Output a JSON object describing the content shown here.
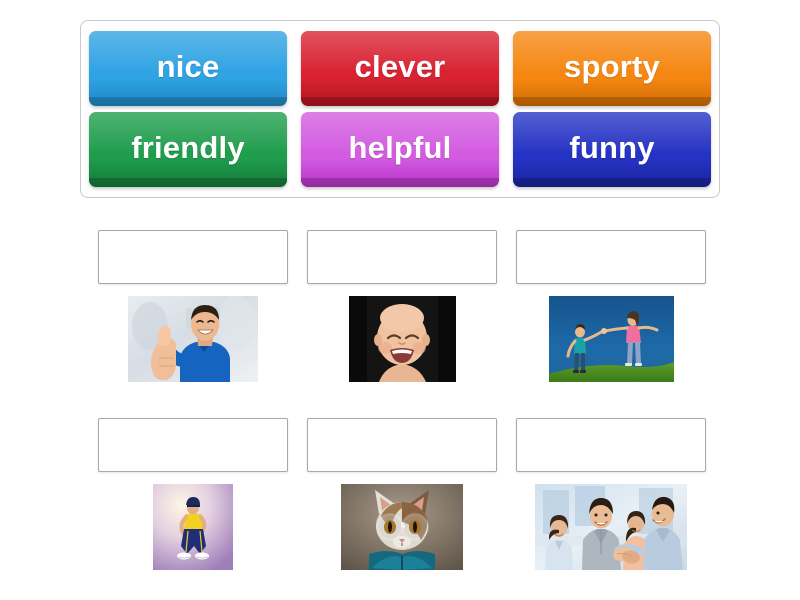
{
  "activity": {
    "type": "match-up-drag-and-drop",
    "background_color": "#ffffff"
  },
  "word_bank": {
    "border_color": "#c9c9c9",
    "rows": [
      [
        {
          "id": "nice",
          "label": "nice",
          "color": "#2fa3e3",
          "color_dark": "#1f87c4"
        },
        {
          "id": "clever",
          "label": "clever",
          "color": "#d92232",
          "color_dark": "#b0151f"
        },
        {
          "id": "sporty",
          "label": "sporty",
          "color": "#f68712",
          "color_dark": "#d06d05"
        }
      ],
      [
        {
          "id": "friendly",
          "label": "friendly",
          "color": "#1f9d4d",
          "color_dark": "#14793a"
        },
        {
          "id": "helpful",
          "label": "helpful",
          "color": "#d35be0",
          "color_dark": "#b832c8"
        },
        {
          "id": "funny",
          "label": "funny",
          "color": "#2533c4",
          "color_dark": "#1a239b"
        }
      ]
    ]
  },
  "answer_rows": [
    {
      "cells": [
        {
          "drop_zone": {
            "value": "",
            "placeholder": ""
          },
          "media": {
            "icon": "thumbs-up-man-photo",
            "alt": "Smiling man in blue t-shirt giving a thumbs up",
            "class": "m-thumbsup"
          }
        },
        {
          "drop_zone": {
            "value": "",
            "placeholder": ""
          },
          "media": {
            "icon": "laughing-baby-photo",
            "alt": "Laughing baby on a black background",
            "class": "m-baby"
          }
        },
        {
          "drop_zone": {
            "value": "",
            "placeholder": ""
          },
          "media": {
            "icon": "children-holding-hands-photo",
            "alt": "Two children holding hands on a grassy hill",
            "class": "m-children"
          }
        }
      ]
    },
    {
      "cells": [
        {
          "drop_zone": {
            "value": "",
            "placeholder": ""
          },
          "media": {
            "icon": "sporty-woman-photo",
            "alt": "Woman in sportswear crouching on a purple background",
            "class": "m-sporty"
          }
        },
        {
          "drop_zone": {
            "value": "",
            "placeholder": ""
          },
          "media": {
            "icon": "cat-reading-book-photo",
            "alt": "Cat wearing glasses reading a blue book",
            "class": "m-cat"
          }
        },
        {
          "drop_zone": {
            "value": "",
            "placeholder": ""
          },
          "media": {
            "icon": "people-handshake-photo",
            "alt": "Group of smiling people shaking hands in an office",
            "class": "m-handshake"
          }
        }
      ]
    }
  ]
}
